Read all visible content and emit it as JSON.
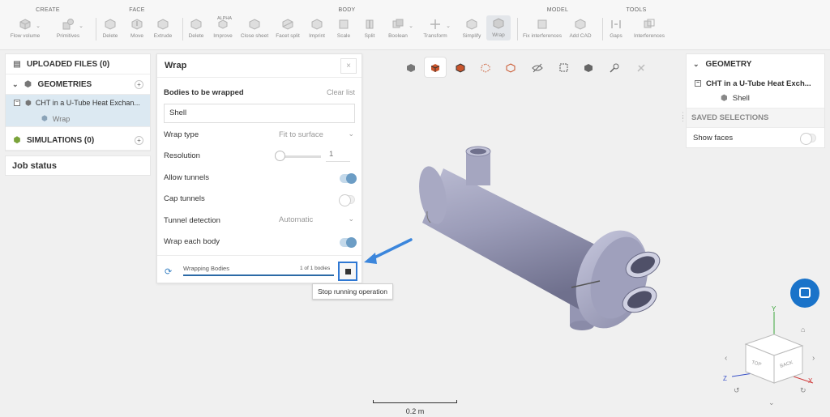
{
  "toolbar": {
    "groups": [
      "CREATE",
      "FACE",
      "BODY",
      "MODEL",
      "TOOLS"
    ],
    "tools": {
      "flow_volume": "Flow volume",
      "primitives": "Primitives",
      "face_delete": "Delete",
      "move": "Move",
      "extrude": "Extrude",
      "body_delete": "Delete",
      "improve": "Improve",
      "close_sheet": "Close sheet",
      "facet_split": "Facet split",
      "imprint": "Imprint",
      "scale": "Scale",
      "split": "Split",
      "boolean": "Boolean",
      "transform": "Transform",
      "simplify": "Simplify",
      "wrap": "Wrap",
      "fix_interferences": "Fix interferences",
      "add_cad": "Add CAD",
      "gaps": "Gaps",
      "interferences": "Interferences"
    },
    "alpha_badge": "ALPHA"
  },
  "left_panel": {
    "uploaded_files": "UPLOADED FILES (0)",
    "geometries": "GEOMETRIES",
    "geometry_item": "CHT in a U-Tube Heat Exchan...",
    "geometry_sub_item": "Wrap",
    "simulations": "SIMULATIONS (0)",
    "job_status": "Job status"
  },
  "wrap_dialog": {
    "title": "Wrap",
    "close": "×",
    "bodies_label": "Bodies to be wrapped",
    "clear_list": "Clear list",
    "bodies_value": "Shell",
    "wrap_type_label": "Wrap type",
    "wrap_type_value": "Fit to surface",
    "resolution_label": "Resolution",
    "resolution_value": "1",
    "allow_tunnels_label": "Allow tunnels",
    "cap_tunnels_label": "Cap tunnels",
    "tunnel_detection_label": "Tunnel detection",
    "tunnel_detection_value": "Automatic",
    "wrap_each_body_label": "Wrap each body",
    "progress_label": "Wrapping Bodies",
    "progress_count": "1 of 1 bodies",
    "tooltip": "Stop running operation"
  },
  "right_panel": {
    "geometry_header": "GEOMETRY",
    "tree_item": "CHT in a U-Tube Heat Exch...",
    "tree_sub_item": "Shell",
    "saved_selections": "SAVED SELECTIONS",
    "show_faces": "Show faces"
  },
  "viewport": {
    "scale_label": "0.2 m",
    "axis_y": "Y",
    "axis_z": "Z",
    "axis_x": "X",
    "cube_top": "TOP",
    "cube_back": "BACK"
  },
  "colors": {
    "accent": "#2f78d3",
    "toggle_on": "#6c9dc5",
    "selected_row": "#dce9f2",
    "model": "#9b9cb9"
  }
}
